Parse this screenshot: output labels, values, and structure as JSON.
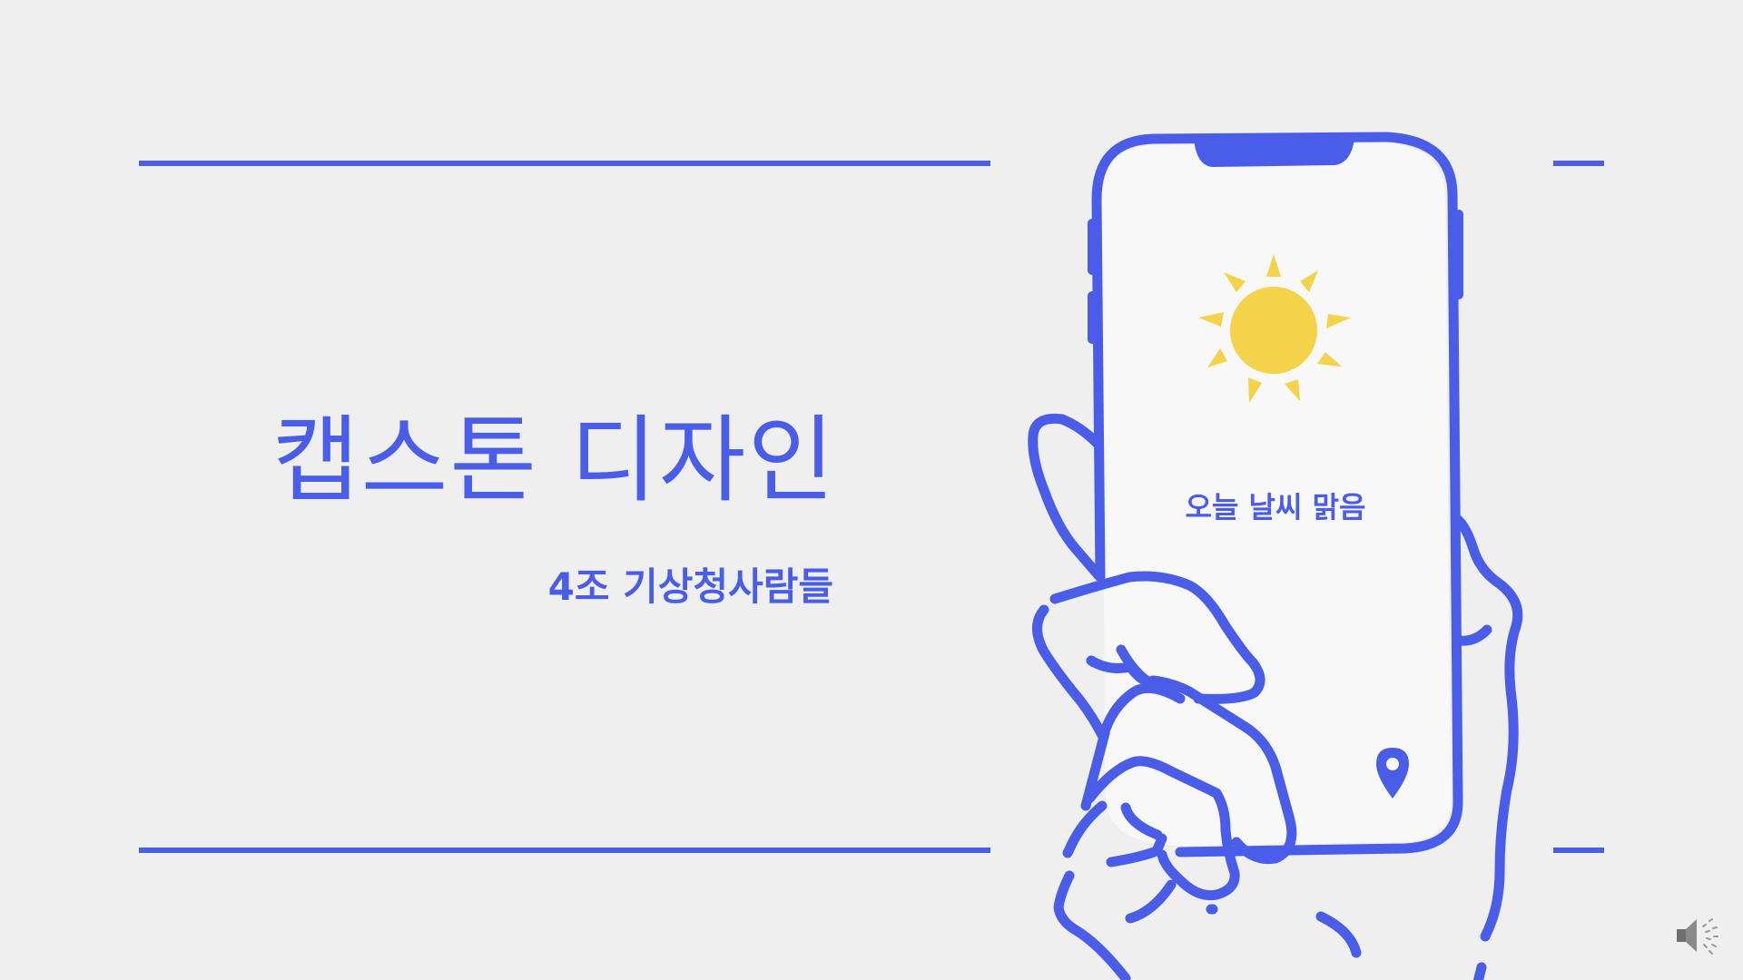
{
  "slide": {
    "title": "캡스톤 디자인",
    "subtitle": "4조 기상청사람들",
    "phone_screen_text": "오늘 날씨 맑음"
  },
  "colors": {
    "accent": "#4a5de8",
    "background": "#efefef",
    "sun": "#f4d24a",
    "screen": "#f8f8f8"
  },
  "icons": {
    "weather": "sun-icon",
    "location": "location-pin-icon",
    "audio": "speaker-icon"
  }
}
